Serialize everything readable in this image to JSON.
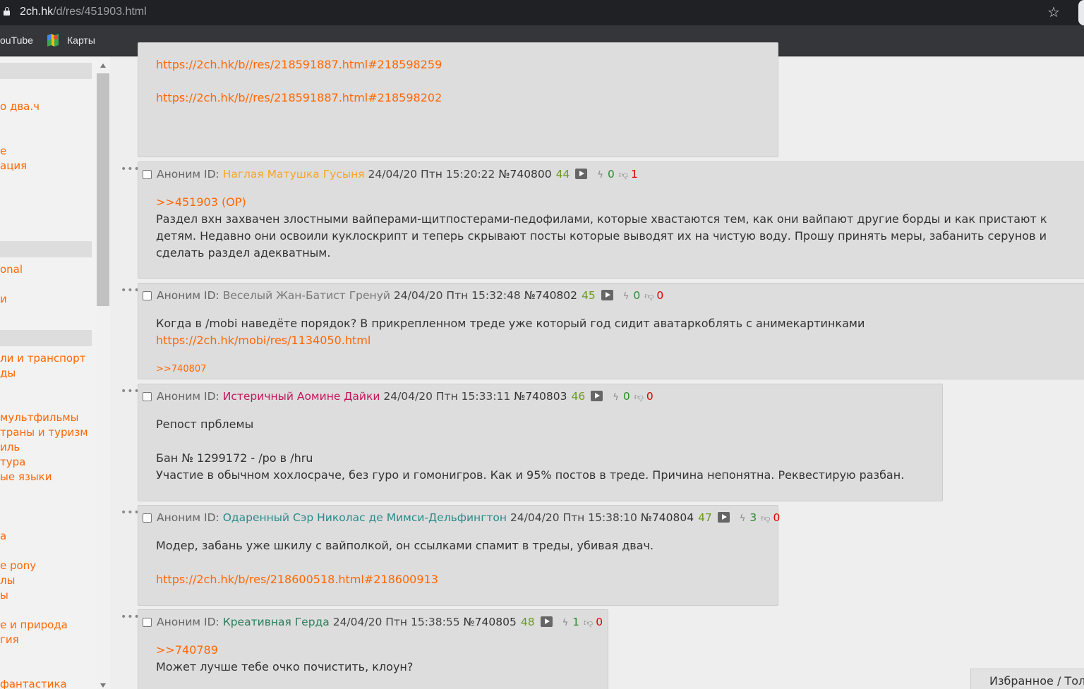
{
  "browser": {
    "url_host": "2ch.hk",
    "url_path": "/d/res/451903.html",
    "bookmarks": [
      "ouTube",
      "Карты"
    ]
  },
  "sidebar": {
    "links": [
      "о два.ч",
      "е",
      "ация",
      "onal",
      "и",
      "ли и транспорт",
      "ды",
      "мультфильмы",
      "траны и туризм",
      "иль",
      "тура",
      "ые языки",
      "a",
      "e pony",
      "лы",
      "ы",
      "е и природа",
      "гия",
      "фантастика"
    ]
  },
  "posts": [
    {
      "body_links": [
        "https://2ch.hk/b//res/218591887.html#218598259",
        "https://2ch.hk/b//res/218591887.html#218598202"
      ]
    },
    {
      "anon": "Аноним ID:",
      "name": "Наглая Матушка Гусыня",
      "name_color": "#f5a623",
      "date": "24/04/20 Птн 15:20:22",
      "num": "№740800",
      "count": "44",
      "likes": "0",
      "dislikes": "1",
      "quote": ">>451903 (OP)",
      "text": "Раздел вхн захвачен злостными вайперами-щитпостерами-педофилами, которые хвастаются тем, как они вайпают другие борды и как пристают к детям. Недавно они освоили куклоскрипт и теперь скрывают посты которые выводят их на чистую воду. Прошу принять меры, забанить серунов и сделать раздел адекватным."
    },
    {
      "anon": "Аноним ID:",
      "name": "Веселый Жан-Батист Гренуй",
      "name_color": "#777777",
      "date": "24/04/20 Птн 15:32:48",
      "num": "№740802",
      "count": "45",
      "likes": "0",
      "dislikes": "0",
      "text": "Когда в /mobi наведёте порядок? В прикрепленном треде уже который год сидит аватаркоблять с анимекартинками",
      "link": "https://2ch.hk/mobi/res/1134050.html",
      "reply": ">>740807"
    },
    {
      "anon": "Аноним ID:",
      "name": "Истеричный Аомине Дайки",
      "name_color": "#c2185b",
      "date": "24/04/20 Птн 15:33:11",
      "num": "№740803",
      "count": "46",
      "likes": "0",
      "dislikes": "0",
      "line1": "Репост прблемы",
      "line2": "Бан № 1299172 - /po в /hru",
      "line3": "Участие в обычном хохлосраче, без гуро и гомонигров. Как и 95% постов в треде. Причина непонятна. Реквестирую разбан."
    },
    {
      "anon": "Аноним ID:",
      "name": "Одаренный Сэр Николас де Мимси-Дельфингтон",
      "name_color": "#2a8a8a",
      "date": "24/04/20 Птн 15:38:10",
      "num": "№740804",
      "count": "47",
      "likes": "3",
      "dislikes": "0",
      "text": "Модер, забань уже шкилу с вайполкой, он ссылками спамит в треды, убивая двач.",
      "link": "https://2ch.hk/b/res/218600518.html#218600913"
    },
    {
      "anon": "Аноним ID:",
      "name": "Креативная Герда",
      "name_color": "#2e7d5b",
      "date": "24/04/20 Птн 15:38:55",
      "num": "№740805",
      "count": "48",
      "likes": "1",
      "dislikes": "0",
      "quote": ">>740789",
      "text": "Может лучше тебе очко почистить, клоун?"
    }
  ],
  "favorites_label": "Избранное / Тол"
}
